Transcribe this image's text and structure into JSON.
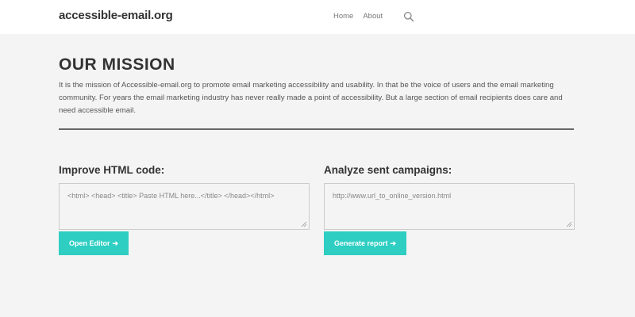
{
  "header": {
    "brand": "accessible-email.org",
    "nav": [
      {
        "label": "Home"
      },
      {
        "label": "About"
      }
    ]
  },
  "mission": {
    "title": "OUR MISSION",
    "text": "It is the mission of Accessible-email.org to promote email marketing accessibility and usability. In that be the voice of users and the email marketing community. For years the email marketing industry has never really made a point of accessibility. But a large section of email recipients does care and need accessible email."
  },
  "improve": {
    "title": "Improve HTML code:",
    "placeholder": "<html> <head> <title> Paste HTML here...</title> </head></html>",
    "button": "Open Editor"
  },
  "analyze": {
    "title": "Analyze sent campaigns:",
    "placeholder": "http://www.url_to_online_version.html",
    "button": "Generate report"
  },
  "colors": {
    "accent": "#2ecec2",
    "background": "#f4f4f4",
    "header": "#ffffff"
  }
}
